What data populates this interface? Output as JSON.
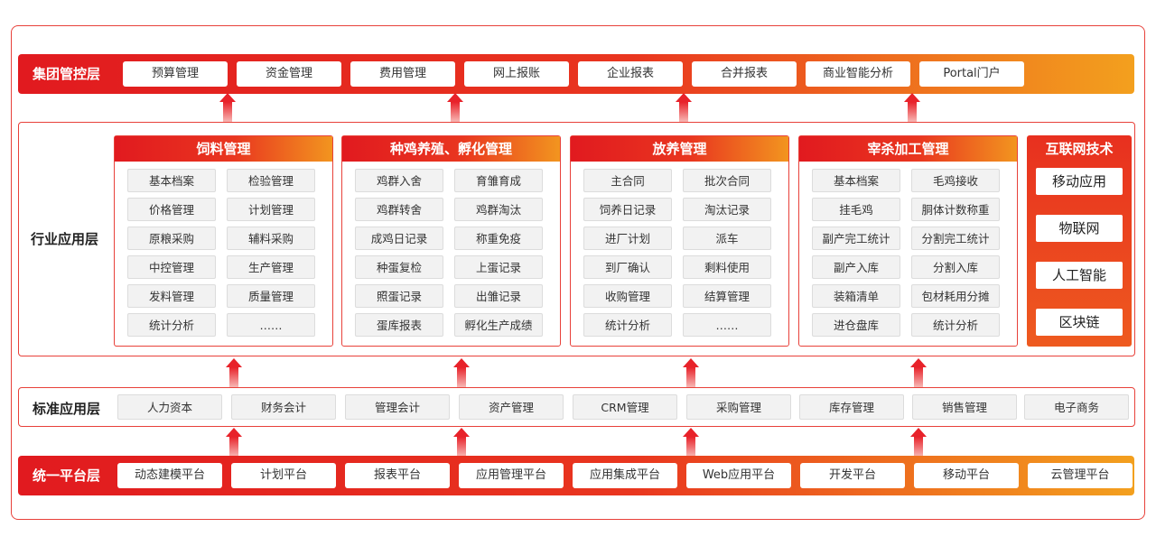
{
  "group_layer": {
    "title": "集团管控层",
    "items": [
      "预算管理",
      "资金管理",
      "费用管理",
      "网上报账",
      "企业报表",
      "合并报表",
      "商业智能分析",
      "Portal门户"
    ]
  },
  "industry_layer": {
    "title": "行业应用层",
    "modules": [
      {
        "title": "饲料管理",
        "items": [
          "基本档案",
          "检验管理",
          "价格管理",
          "计划管理",
          "原粮采购",
          "辅料采购",
          "中控管理",
          "生产管理",
          "发料管理",
          "质量管理",
          "统计分析",
          "……"
        ]
      },
      {
        "title": "种鸡养殖、孵化管理",
        "items": [
          "鸡群入舍",
          "育雏育成",
          "鸡群转舍",
          "鸡群淘汰",
          "成鸡日记录",
          "称重免疫",
          "种蛋复检",
          "上蛋记录",
          "照蛋记录",
          "出雏记录",
          "蛋库报表",
          "孵化生产成绩"
        ]
      },
      {
        "title": "放养管理",
        "items": [
          "主合同",
          "批次合同",
          "饲养日记录",
          "淘汰记录",
          "进厂计划",
          "派车",
          "到厂确认",
          "剩料使用",
          "收购管理",
          "结算管理",
          "统计分析",
          "……"
        ]
      },
      {
        "title": "宰杀加工管理",
        "items": [
          "基本档案",
          "毛鸡接收",
          "挂毛鸡",
          "胴体计数称重",
          "副产完工统计",
          "分割完工统计",
          "副产入库",
          "分割入库",
          "装箱清单",
          "包材耗用分摊",
          "进仓盘库",
          "统计分析"
        ]
      }
    ],
    "internet": {
      "title": "互联网技术",
      "items": [
        "移动应用",
        "物联网",
        "人工智能",
        "区块链"
      ]
    }
  },
  "standard_layer": {
    "title": "标准应用层",
    "items": [
      "人力资本",
      "财务会计",
      "管理会计",
      "资产管理",
      "CRM管理",
      "采购管理",
      "库存管理",
      "销售管理",
      "电子商务"
    ]
  },
  "platform_layer": {
    "title": "统一平台层",
    "items": [
      "动态建模平台",
      "计划平台",
      "报表平台",
      "应用管理平台",
      "应用集成平台",
      "Web应用平台",
      "开发平台",
      "移动平台",
      "云管理平台"
    ]
  }
}
